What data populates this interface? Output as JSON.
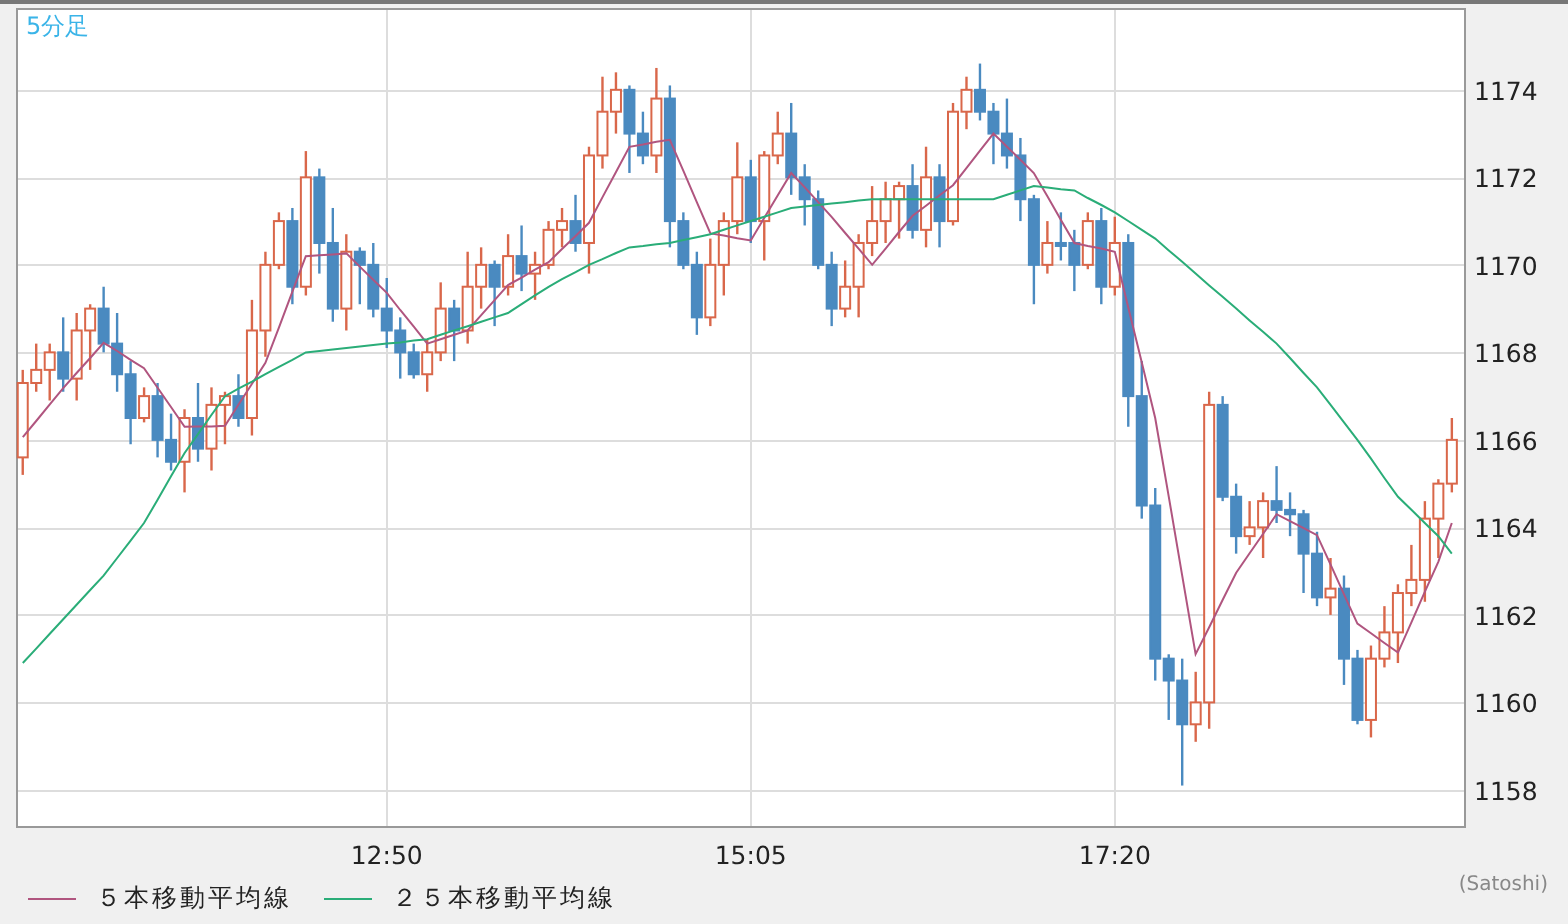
{
  "chart": {
    "chart_data": {
      "type": "candlestick",
      "title": "5分足",
      "categories": [
        null,
        null,
        null,
        null,
        null,
        null,
        null,
        null,
        null,
        null,
        null,
        null,
        null,
        null,
        null,
        null,
        null,
        null,
        null,
        null,
        null,
        null,
        null,
        null,
        null,
        null,
        null,
        "12:50",
        null,
        null,
        null,
        null,
        null,
        null,
        null,
        null,
        null,
        null,
        null,
        null,
        null,
        null,
        null,
        null,
        null,
        null,
        null,
        null,
        null,
        null,
        null,
        null,
        null,
        null,
        "15:05",
        null,
        null,
        null,
        null,
        null,
        null,
        null,
        null,
        null,
        null,
        null,
        null,
        null,
        null,
        null,
        null,
        null,
        null,
        null,
        null,
        null,
        null,
        null,
        null,
        null,
        null,
        "17:20",
        null,
        null,
        null,
        null,
        null,
        null,
        null,
        null,
        null,
        null,
        null,
        null,
        null,
        null,
        null,
        null,
        null,
        null,
        null,
        null,
        null,
        null,
        null,
        null,
        null
      ],
      "ylim": [
        1157.13,
        1175.87
      ],
      "grid": true,
      "yticks": [
        1158,
        1160,
        1162,
        1164,
        1166,
        1168,
        1170,
        1172,
        1174
      ],
      "ohlc": [
        [
          1165.6,
          1167.6,
          1165.2,
          1167.3
        ],
        [
          1167.3,
          1168.2,
          1167.1,
          1167.6
        ],
        [
          1167.6,
          1168.2,
          1166.9,
          1168.0
        ],
        [
          1168.0,
          1168.8,
          1167.1,
          1167.4
        ],
        [
          1167.4,
          1168.9,
          1166.9,
          1168.5
        ],
        [
          1168.5,
          1169.1,
          1167.6,
          1169.0
        ],
        [
          1169.0,
          1169.5,
          1168.0,
          1168.2
        ],
        [
          1168.2,
          1168.9,
          1167.1,
          1167.5
        ],
        [
          1167.5,
          1167.8,
          1165.9,
          1166.5
        ],
        [
          1166.5,
          1167.2,
          1166.4,
          1167.0
        ],
        [
          1167.0,
          1167.3,
          1165.6,
          1166.0
        ],
        [
          1166.0,
          1166.6,
          1165.3,
          1165.5
        ],
        [
          1165.5,
          1166.7,
          1164.8,
          1166.5
        ],
        [
          1166.5,
          1167.3,
          1165.5,
          1165.8
        ],
        [
          1165.8,
          1167.2,
          1165.3,
          1166.8
        ],
        [
          1166.8,
          1167.1,
          1165.9,
          1167.0
        ],
        [
          1167.0,
          1167.5,
          1166.3,
          1166.5
        ],
        [
          1166.5,
          1169.2,
          1166.1,
          1168.5
        ],
        [
          1168.5,
          1170.3,
          1167.9,
          1170.0
        ],
        [
          1170.0,
          1171.2,
          1169.9,
          1171.0
        ],
        [
          1171.0,
          1171.3,
          1169.1,
          1169.5
        ],
        [
          1169.5,
          1172.6,
          1169.3,
          1172.0
        ],
        [
          1172.0,
          1172.2,
          1169.8,
          1170.5
        ],
        [
          1170.5,
          1171.3,
          1168.7,
          1169.0
        ],
        [
          1169.0,
          1170.7,
          1168.5,
          1170.3
        ],
        [
          1170.3,
          1170.4,
          1169.1,
          1170.0
        ],
        [
          1170.0,
          1170.5,
          1168.8,
          1169.0
        ],
        [
          1169.0,
          1169.7,
          1168.1,
          1168.5
        ],
        [
          1168.5,
          1168.8,
          1167.4,
          1168.0
        ],
        [
          1168.0,
          1168.2,
          1167.4,
          1167.5
        ],
        [
          1167.5,
          1168.3,
          1167.1,
          1168.0
        ],
        [
          1168.0,
          1169.6,
          1167.8,
          1169.0
        ],
        [
          1169.0,
          1169.2,
          1167.8,
          1168.5
        ],
        [
          1168.5,
          1170.3,
          1168.2,
          1169.5
        ],
        [
          1169.5,
          1170.4,
          1169.0,
          1170.0
        ],
        [
          1170.0,
          1170.1,
          1168.6,
          1169.5
        ],
        [
          1169.5,
          1170.7,
          1169.3,
          1170.2
        ],
        [
          1170.2,
          1170.9,
          1169.4,
          1169.8
        ],
        [
          1169.8,
          1170.3,
          1169.2,
          1170.0
        ],
        [
          1170.0,
          1171.0,
          1169.9,
          1170.8
        ],
        [
          1170.8,
          1171.3,
          1170.4,
          1171.0
        ],
        [
          1171.0,
          1171.6,
          1170.3,
          1170.5
        ],
        [
          1170.5,
          1172.7,
          1169.8,
          1172.5
        ],
        [
          1172.5,
          1174.3,
          1172.2,
          1173.5
        ],
        [
          1173.5,
          1174.4,
          1173.0,
          1174.0
        ],
        [
          1174.0,
          1174.1,
          1172.1,
          1173.0
        ],
        [
          1173.0,
          1173.5,
          1172.3,
          1172.5
        ],
        [
          1172.5,
          1174.5,
          1172.1,
          1173.8
        ],
        [
          1173.8,
          1174.1,
          1170.4,
          1171.0
        ],
        [
          1171.0,
          1171.2,
          1169.9,
          1170.0
        ],
        [
          1170.0,
          1170.3,
          1168.4,
          1168.8
        ],
        [
          1168.8,
          1170.6,
          1168.6,
          1170.0
        ],
        [
          1170.0,
          1171.2,
          1169.3,
          1171.0
        ],
        [
          1171.0,
          1172.8,
          1170.7,
          1172.0
        ],
        [
          1172.0,
          1172.4,
          1170.5,
          1171.0
        ],
        [
          1171.0,
          1172.6,
          1170.1,
          1172.5
        ],
        [
          1172.5,
          1173.5,
          1172.3,
          1173.0
        ],
        [
          1173.0,
          1173.7,
          1171.6,
          1172.0
        ],
        [
          1172.0,
          1172.3,
          1170.9,
          1171.5
        ],
        [
          1171.5,
          1171.7,
          1169.9,
          1170.0
        ],
        [
          1170.0,
          1170.3,
          1168.6,
          1169.0
        ],
        [
          1169.0,
          1170.1,
          1168.8,
          1169.5
        ],
        [
          1169.5,
          1170.7,
          1168.8,
          1170.5
        ],
        [
          1170.5,
          1171.8,
          1170.2,
          1171.0
        ],
        [
          1171.0,
          1171.9,
          1170.5,
          1171.5
        ],
        [
          1171.5,
          1171.9,
          1170.6,
          1171.8
        ],
        [
          1171.8,
          1172.3,
          1170.6,
          1170.8
        ],
        [
          1170.8,
          1172.7,
          1170.4,
          1172.0
        ],
        [
          1172.0,
          1172.3,
          1170.4,
          1171.0
        ],
        [
          1171.0,
          1173.7,
          1170.9,
          1173.5
        ],
        [
          1173.5,
          1174.3,
          1173.1,
          1174.0
        ],
        [
          1174.0,
          1174.6,
          1173.3,
          1173.5
        ],
        [
          1173.5,
          1173.7,
          1172.3,
          1173.0
        ],
        [
          1173.0,
          1173.8,
          1172.2,
          1172.5
        ],
        [
          1172.5,
          1172.9,
          1171.0,
          1171.5
        ],
        [
          1171.5,
          1171.6,
          1169.1,
          1170.0
        ],
        [
          1170.0,
          1171.0,
          1169.8,
          1170.5
        ],
        [
          1170.5,
          1171.2,
          1170.1,
          1170.5
        ],
        [
          1170.5,
          1170.8,
          1169.4,
          1170.0
        ],
        [
          1170.0,
          1171.2,
          1169.9,
          1171.0
        ],
        [
          1171.0,
          1171.3,
          1169.1,
          1169.5
        ],
        [
          1169.5,
          1171.1,
          1169.3,
          1170.5
        ],
        [
          1170.5,
          1170.7,
          1166.3,
          1167.0
        ],
        [
          1167.0,
          1167.8,
          1164.2,
          1164.5
        ],
        [
          1164.5,
          1164.9,
          1160.5,
          1161.0
        ],
        [
          1161.0,
          1161.1,
          1159.6,
          1160.5
        ],
        [
          1160.5,
          1161.0,
          1158.1,
          1159.5
        ],
        [
          1159.5,
          1160.7,
          1159.1,
          1160.0
        ],
        [
          1160.0,
          1167.1,
          1159.4,
          1166.8
        ],
        [
          1166.8,
          1167.0,
          1164.6,
          1164.7
        ],
        [
          1164.7,
          1165.0,
          1163.4,
          1163.8
        ],
        [
          1163.8,
          1164.6,
          1163.6,
          1164.0
        ],
        [
          1164.0,
          1164.8,
          1163.3,
          1164.6
        ],
        [
          1164.6,
          1165.4,
          1164.1,
          1164.4
        ],
        [
          1164.4,
          1164.8,
          1163.8,
          1164.3
        ],
        [
          1164.3,
          1164.4,
          1162.5,
          1163.4
        ],
        [
          1163.4,
          1163.9,
          1162.2,
          1162.4
        ],
        [
          1162.4,
          1163.3,
          1162.0,
          1162.6
        ],
        [
          1162.6,
          1162.9,
          1160.4,
          1161.0
        ],
        [
          1161.0,
          1161.2,
          1159.5,
          1159.6
        ],
        [
          1159.6,
          1161.3,
          1159.2,
          1161.0
        ],
        [
          1161.0,
          1162.2,
          1160.8,
          1161.6
        ],
        [
          1161.6,
          1162.7,
          1160.9,
          1162.5
        ],
        [
          1162.5,
          1163.6,
          1162.2,
          1162.8
        ],
        [
          1162.8,
          1164.6,
          1162.3,
          1164.2
        ],
        [
          1164.2,
          1165.1,
          1163.3,
          1165.0
        ],
        [
          1165.0,
          1166.5,
          1164.8,
          1166.0
        ]
      ]
    }
  },
  "moving_averages": {
    "chart_data": {
      "type": "line",
      "ylim": [
        1157.13,
        1175.87
      ],
      "series": [
        {
          "name": "５本移動平均線",
          "color": "#b0557f",
          "values": [
            1166.06,
            1166.43,
            1166.81,
            1167.18,
            1167.53,
            1167.87,
            1168.22,
            1168.03,
            1167.83,
            1167.64,
            1167.19,
            1166.75,
            1166.3,
            1166.31,
            1166.31,
            1166.32,
            1166.8,
            1167.28,
            1167.76,
            1168.57,
            1169.39,
            1170.2,
            1170.22,
            1170.24,
            1170.26,
            1169.96,
            1169.66,
            1169.36,
            1168.97,
            1168.59,
            1168.2,
            1168.3,
            1168.4,
            1168.5,
            1168.85,
            1169.19,
            1169.54,
            1169.71,
            1169.89,
            1170.06,
            1170.36,
            1170.66,
            1170.96,
            1171.54,
            1172.12,
            1172.7,
            1172.75,
            1172.81,
            1172.86,
            1172.15,
            1171.43,
            1170.72,
            1170.67,
            1170.61,
            1170.56,
            1171.07,
            1171.59,
            1172.1,
            1171.77,
            1171.43,
            1171.1,
            1170.73,
            1170.37,
            1170.0,
            1170.37,
            1170.75,
            1171.12,
            1171.35,
            1171.59,
            1171.82,
            1172.21,
            1172.61,
            1173.0,
            1172.7,
            1172.4,
            1172.1,
            1171.57,
            1171.03,
            1170.5,
            1170.43,
            1170.37,
            1170.3,
            1169.03,
            1167.77,
            1166.5,
            1164.7,
            1162.9,
            1161.1,
            1161.72,
            1162.34,
            1162.96,
            1163.41,
            1163.85,
            1164.3,
            1164.14,
            1163.98,
            1163.82,
            1163.15,
            1162.47,
            1161.8,
            1161.58,
            1161.36,
            1161.14,
            1161.83,
            1162.53,
            1163.22,
            1164.1
          ]
        },
        {
          "name": "２５本移動平均線",
          "color": "#2aad78",
          "values": [
            1160.9,
            1161.23,
            1161.57,
            1161.9,
            1162.23,
            1162.57,
            1162.9,
            1163.3,
            1163.7,
            1164.1,
            1164.63,
            1165.17,
            1165.7,
            1166.13,
            1166.57,
            1167.0,
            1167.17,
            1167.33,
            1167.5,
            1167.67,
            1167.83,
            1168.0,
            1168.03,
            1168.07,
            1168.1,
            1168.13,
            1168.17,
            1168.2,
            1168.23,
            1168.27,
            1168.3,
            1168.4,
            1168.5,
            1168.6,
            1168.7,
            1168.8,
            1168.9,
            1169.1,
            1169.3,
            1169.5,
            1169.67,
            1169.83,
            1170.0,
            1170.13,
            1170.27,
            1170.4,
            1170.43,
            1170.47,
            1170.5,
            1170.57,
            1170.63,
            1170.7,
            1170.8,
            1170.9,
            1171.0,
            1171.1,
            1171.2,
            1171.3,
            1171.33,
            1171.37,
            1171.4,
            1171.43,
            1171.47,
            1171.5,
            1171.5,
            1171.5,
            1171.5,
            1171.5,
            1171.5,
            1171.5,
            1171.5,
            1171.5,
            1171.5,
            1171.6,
            1171.7,
            1171.8,
            1171.77,
            1171.73,
            1171.7,
            1171.53,
            1171.37,
            1171.2,
            1171.0,
            1170.8,
            1170.6,
            1170.33,
            1170.07,
            1169.8,
            1169.53,
            1169.27,
            1169.0,
            1168.73,
            1168.47,
            1168.2,
            1167.87,
            1167.53,
            1167.2,
            1166.8,
            1166.4,
            1166.0,
            1165.57,
            1165.13,
            1164.7,
            1164.4,
            1164.1,
            1163.8,
            1163.4
          ]
        }
      ]
    }
  },
  "credit": "(Satoshi)"
}
